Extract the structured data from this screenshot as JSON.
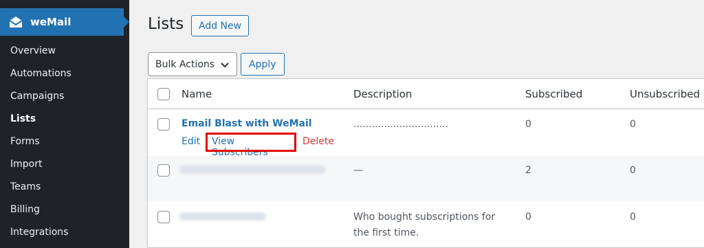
{
  "sidebar": {
    "brand": {
      "label": "weMail",
      "icon": "envelope-icon"
    },
    "items": [
      {
        "label": "Overview"
      },
      {
        "label": "Automations"
      },
      {
        "label": "Campaigns"
      },
      {
        "label": "Lists",
        "active": true
      },
      {
        "label": "Forms"
      },
      {
        "label": "Import"
      },
      {
        "label": "Teams"
      },
      {
        "label": "Billing"
      },
      {
        "label": "Integrations"
      }
    ]
  },
  "header": {
    "title": "Lists",
    "add_new_label": "Add New"
  },
  "toolbar": {
    "bulk_actions_label": "Bulk Actions",
    "apply_label": "Apply"
  },
  "table": {
    "columns": {
      "name": "Name",
      "description": "Description",
      "subscribed": "Subscribed",
      "unsubscribed": "Unsubscribed"
    },
    "row_actions": {
      "edit": "Edit",
      "view_subscribers": "View Subscribers",
      "delete": "Delete"
    },
    "rows": [
      {
        "name": "Email Blast with WeMail",
        "description": "...............................",
        "subscribed": "0",
        "unsubscribed": "0"
      },
      {
        "name": "",
        "description": "—",
        "subscribed": "2",
        "unsubscribed": "0"
      },
      {
        "name": "",
        "description_line1": "Who bought subscriptions for",
        "description_line2": "the first time.",
        "subscribed": "0",
        "unsubscribed": "0"
      }
    ]
  },
  "colors": {
    "sidebar_bg": "#1d2327",
    "accent": "#2271b1",
    "danger": "#d63638",
    "highlight": "#e00000"
  }
}
